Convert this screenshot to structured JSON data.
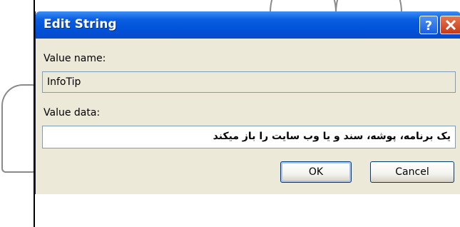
{
  "dialog": {
    "title": "Edit String",
    "help_glyph": "?",
    "close_glyph": "x",
    "value_name_label": "Value name:",
    "value_name": "InfoTip",
    "value_data_label": "Value data:",
    "value_data": "یک برنامه، پوشه، سند و یا وب سایت را باز میکند",
    "ok_label": "OK",
    "cancel_label": "Cancel"
  },
  "icons": {
    "help": "help-icon",
    "close": "close-icon"
  },
  "colors": {
    "titlebar": "#0a5ee0",
    "dialog_bg": "#ece9d8",
    "close_button": "#c33a1a"
  }
}
